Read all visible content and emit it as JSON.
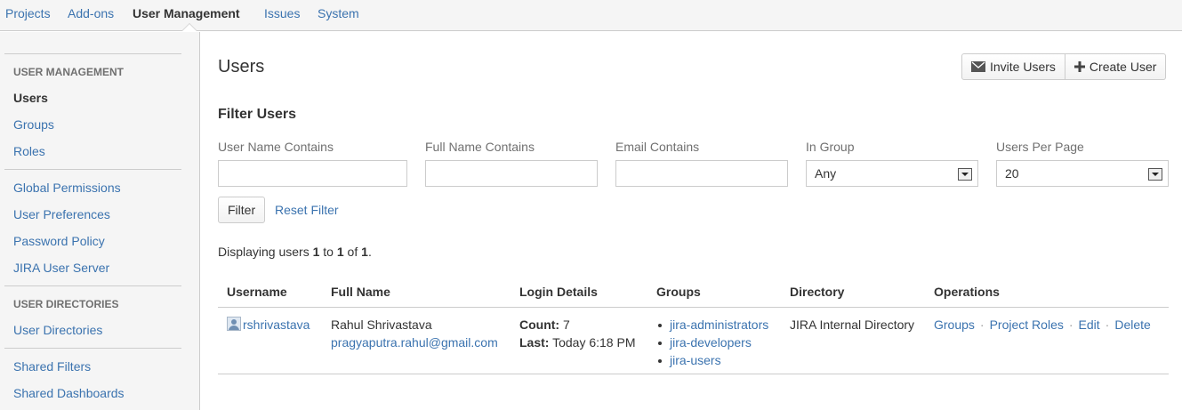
{
  "topnav": {
    "items": [
      {
        "label": "Projects"
      },
      {
        "label": "Add-ons"
      },
      {
        "label": "User Management"
      },
      {
        "label": "Issues"
      },
      {
        "label": "System"
      }
    ]
  },
  "sidebar": {
    "user_management_heading": "USER MANAGEMENT",
    "items": [
      {
        "label": "Users"
      },
      {
        "label": "Groups"
      },
      {
        "label": "Roles"
      },
      {
        "label": "Global Permissions"
      },
      {
        "label": "User Preferences"
      },
      {
        "label": "Password Policy"
      },
      {
        "label": "JIRA User Server"
      }
    ],
    "user_directories_heading": "USER DIRECTORIES",
    "directory_items": [
      {
        "label": "User Directories"
      }
    ],
    "bottom_items": [
      {
        "label": "Shared Filters"
      },
      {
        "label": "Shared Dashboards"
      }
    ]
  },
  "main": {
    "title": "Users",
    "invite_users_label": "Invite Users",
    "create_user_label": "Create User",
    "filter_title": "Filter Users",
    "filters": {
      "username_label": "User Name Contains",
      "username_value": "",
      "fullname_label": "Full Name Contains",
      "fullname_value": "",
      "email_label": "Email Contains",
      "email_value": "",
      "group_label": "In Group",
      "group_value": "Any",
      "per_page_label": "Users Per Page",
      "per_page_value": "20"
    },
    "filter_button": "Filter",
    "reset_filter": "Reset Filter",
    "display": {
      "prefix": "Displaying users ",
      "from": "1",
      "to_word": " to ",
      "to": "1",
      "of_word": " of ",
      "total": "1",
      "suffix": "."
    },
    "table": {
      "headers": [
        "Username",
        "Full Name",
        "Login Details",
        "Groups",
        "Directory",
        "Operations"
      ],
      "rows": [
        {
          "username": "rshrivastava",
          "full_name": "Rahul Shrivastava",
          "email": "pragyaputra.rahul@gmail.com",
          "count_label": "Count:",
          "count_value": " 7",
          "last_label": "Last:",
          "last_value": " Today 6:18 PM",
          "groups": [
            "jira-administrators",
            "jira-developers",
            "jira-users"
          ],
          "directory": "JIRA Internal Directory",
          "operations": [
            "Groups",
            "Project Roles",
            "Edit",
            "Delete"
          ],
          "operations_separator": "·"
        }
      ]
    }
  }
}
